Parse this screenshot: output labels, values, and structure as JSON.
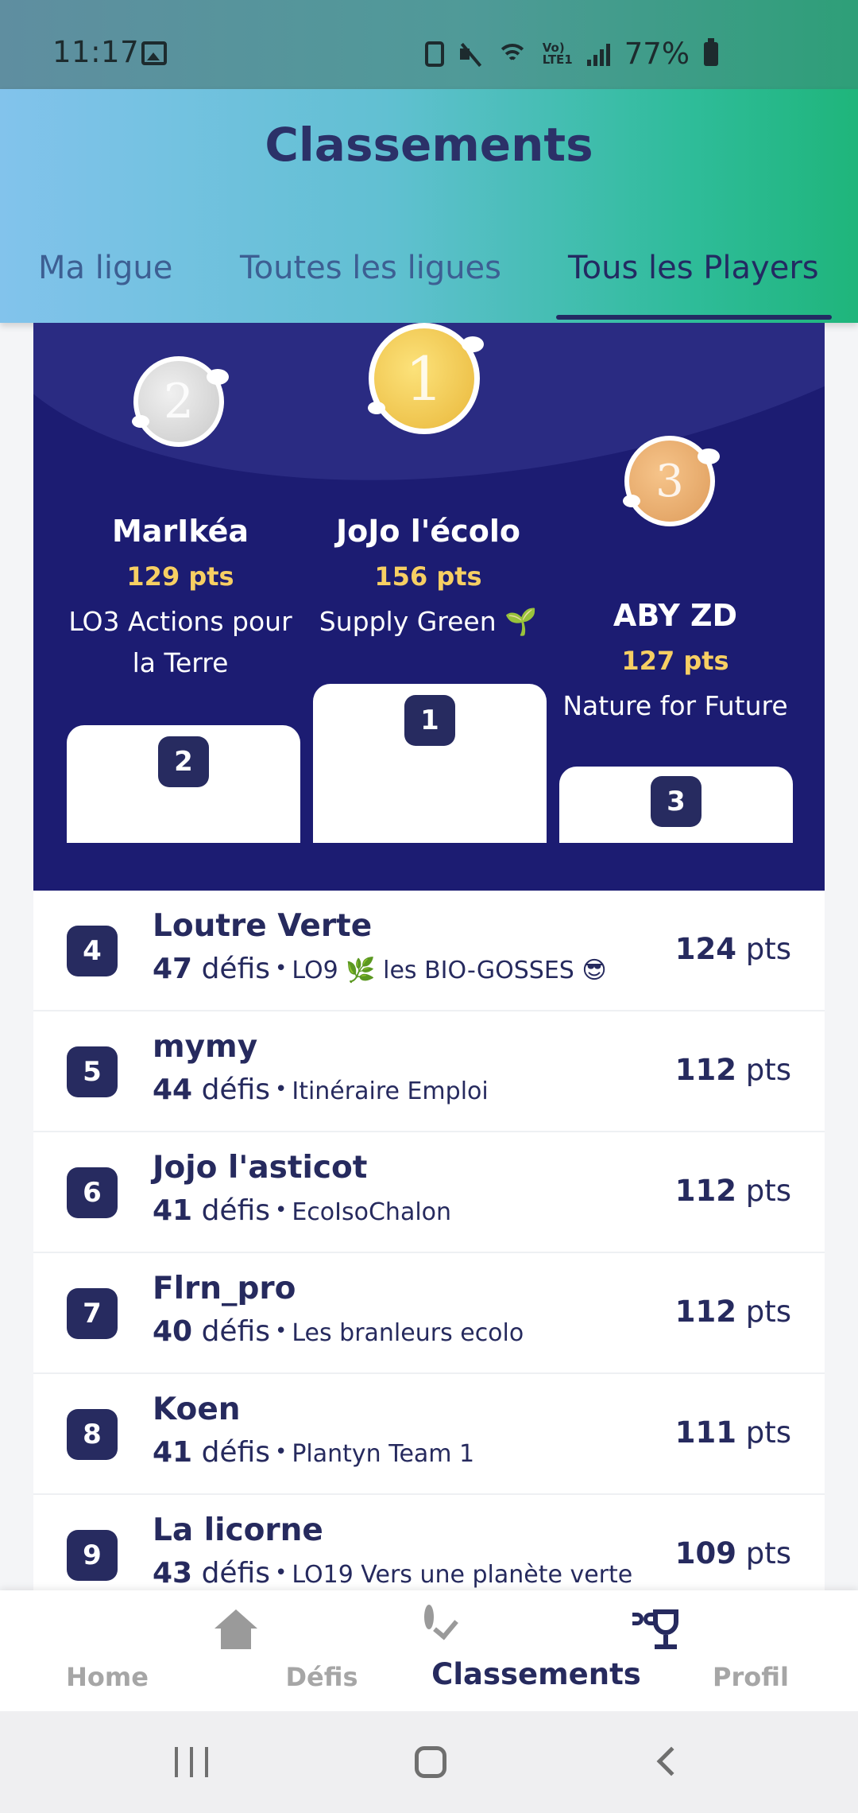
{
  "status_bar": {
    "time": "11:17",
    "lte_label_top": "Vo)",
    "lte_label_bottom": "LTE1",
    "battery": "77%"
  },
  "header": {
    "title": "Classements",
    "tabs": [
      {
        "label": "Ma ligue",
        "active": false
      },
      {
        "label": "Toutes les ligues",
        "active": false
      },
      {
        "label": "Tous les Players",
        "active": true
      }
    ]
  },
  "podium": {
    "first": {
      "rank": "1",
      "name": "JoJo l'écolo",
      "points": "156 pts",
      "team": "Supply Green 🌱"
    },
    "second": {
      "rank": "2",
      "name": "MarIkéa",
      "points": "129 pts",
      "team_line1": "LO3 Actions pour",
      "team_line2": "la Terre"
    },
    "third": {
      "rank": "3",
      "name": "ABY ZD",
      "points": "127 pts",
      "team": "Nature for Future"
    }
  },
  "ranking": [
    {
      "rank": "4",
      "name": "Loutre Verte",
      "defis_count": "47",
      "defis_label": "défis",
      "team": "LO9 🌿 les BIO-GOSSES 😎",
      "points": "124",
      "points_unit": "pts"
    },
    {
      "rank": "5",
      "name": "mymy",
      "defis_count": "44",
      "defis_label": "défis",
      "team": "Itinéraire Emploi",
      "points": "112",
      "points_unit": "pts"
    },
    {
      "rank": "6",
      "name": "Jojo l'asticot",
      "defis_count": "41",
      "defis_label": "défis",
      "team": "EcoIsoChalon",
      "points": "112",
      "points_unit": "pts"
    },
    {
      "rank": "7",
      "name": "Flrn_pro",
      "defis_count": "40",
      "defis_label": "défis",
      "team": "Les branleurs ecolo",
      "points": "112",
      "points_unit": "pts"
    },
    {
      "rank": "8",
      "name": "Koen",
      "defis_count": "41",
      "defis_label": "défis",
      "team": "Plantyn Team 1",
      "points": "111",
      "points_unit": "pts"
    },
    {
      "rank": "9",
      "name": "La licorne",
      "defis_count": "43",
      "defis_label": "défis",
      "team": "LO19 Vers une planète verte",
      "points": "109",
      "points_unit": "pts"
    }
  ],
  "bottom_nav": [
    {
      "label": "Home",
      "icon": "home-icon",
      "active": false
    },
    {
      "label": "Défis",
      "icon": "check-circle-icon",
      "active": false
    },
    {
      "label": "Classements",
      "icon": "trophy-icon",
      "active": true
    },
    {
      "label": "Profil",
      "icon": "person-icon",
      "active": false
    }
  ],
  "colors": {
    "primary_dark": "#262a5e",
    "podium_bg": "#1c1c72",
    "points_gold": "#f7cf63",
    "inactive_gray": "#a6a6a6"
  }
}
